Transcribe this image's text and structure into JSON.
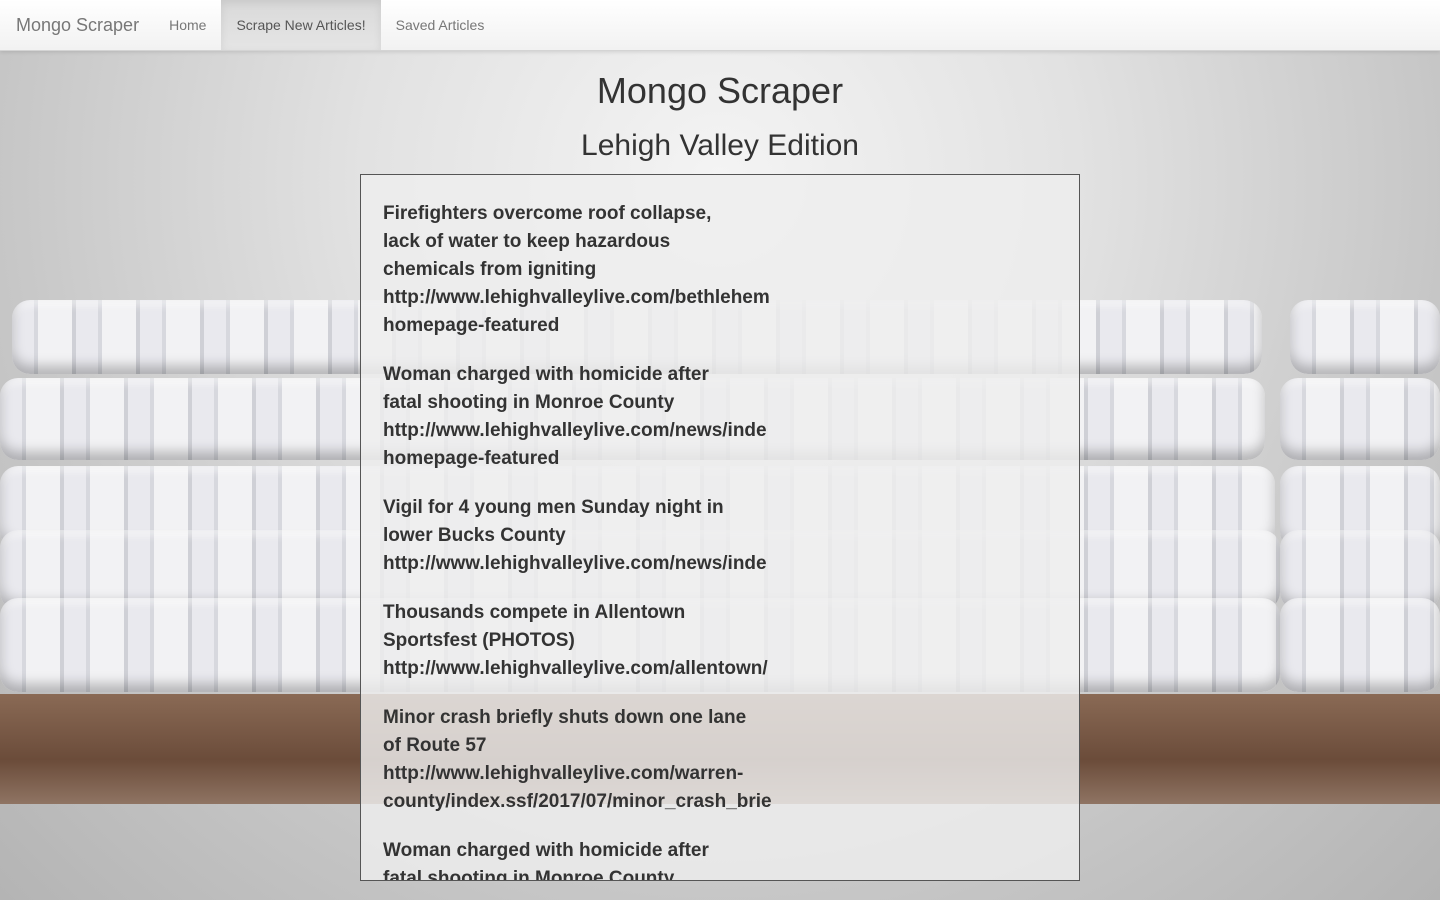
{
  "navbar": {
    "brand": "Mongo Scraper",
    "links": [
      {
        "label": "Home",
        "active": false
      },
      {
        "label": "Scrape New Articles!",
        "active": true
      },
      {
        "label": "Saved Articles",
        "active": false
      }
    ]
  },
  "header": {
    "title": "Mongo Scraper",
    "subtitle": "Lehigh Valley Edition"
  },
  "articles": [
    {
      "headline": "Firefighters overcome roof collapse,\nlack of water to keep hazardous\nchemicals from igniting",
      "link_lines": [
        "http://www.lehighvalleylive.com/bethlehem",
        "homepage-featured"
      ]
    },
    {
      "headline": "Woman charged with homicide after\nfatal shooting in Monroe County",
      "link_lines": [
        "http://www.lehighvalleylive.com/news/inde",
        "homepage-featured"
      ]
    },
    {
      "headline": "Vigil for 4 young men Sunday night in\nlower Bucks County",
      "link_lines": [
        "http://www.lehighvalleylive.com/news/inde"
      ]
    },
    {
      "headline": "Thousands compete in Allentown\nSportsfest (PHOTOS)",
      "link_lines": [
        "http://www.lehighvalleylive.com/allentown/"
      ]
    },
    {
      "headline": "Minor crash briefly shuts down one lane\nof Route 57",
      "link_lines": [
        "http://www.lehighvalleylive.com/warren-",
        "county/index.ssf/2017/07/minor_crash_brie"
      ]
    },
    {
      "headline": "Woman charged with homicide after\nfatal shooting in Monroe County",
      "link_lines": []
    }
  ],
  "colors": {
    "panel_border": "#555555",
    "text": "#333333",
    "nav_text": "#777777",
    "nav_active_bg": "#e0e0e0"
  }
}
